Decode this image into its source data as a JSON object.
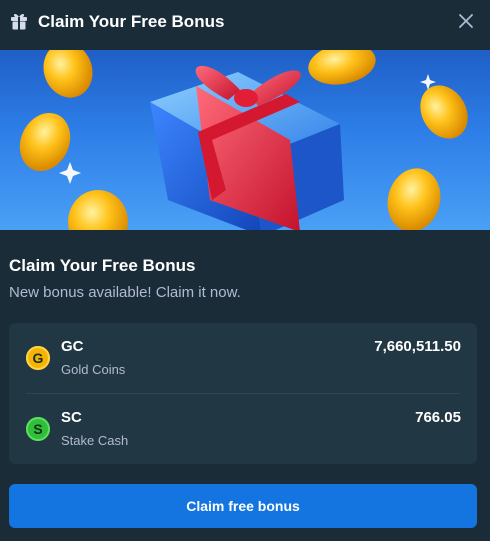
{
  "header": {
    "icon": "gift-icon",
    "title": "Claim Your Free Bonus",
    "close_icon": "close-icon"
  },
  "banner": {
    "image": "gift-box-with-gold-coins-illustration"
  },
  "body": {
    "title": "Claim Your Free Bonus",
    "subtitle": "New bonus available! Claim it now."
  },
  "balances": [
    {
      "icon_letter": "G",
      "icon_color": "#f5b400",
      "code": "GC",
      "name": "Gold Coins",
      "amount": "7,660,511.50"
    },
    {
      "icon_letter": "S",
      "icon_color": "#2fbf3a",
      "code": "SC",
      "name": "Stake Cash",
      "amount": "766.05"
    }
  ],
  "actions": {
    "claim_label": "Claim free bonus"
  },
  "colors": {
    "background": "#1a2c38",
    "card": "#213743",
    "accent_button": "#1475e1",
    "muted_text": "#b1bad3"
  }
}
